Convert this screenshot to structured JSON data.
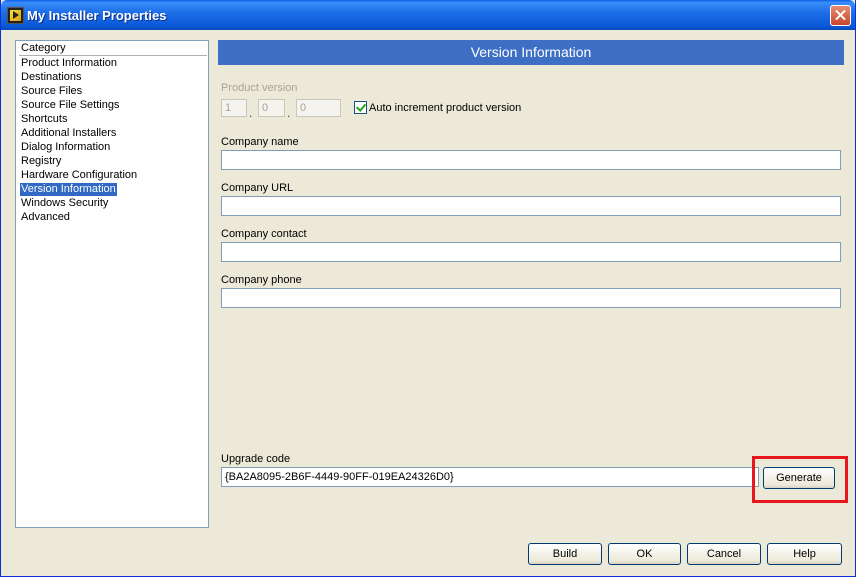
{
  "window": {
    "title": "My Installer Properties"
  },
  "sidebar": {
    "header": "Category",
    "items": [
      "Product Information",
      "Destinations",
      "Source Files",
      "Source File Settings",
      "Shortcuts",
      "Additional Installers",
      "Dialog Information",
      "Registry",
      "Hardware Configuration",
      "Version Information",
      "Windows Security",
      "Advanced"
    ],
    "selected": "Version Information"
  },
  "panel": {
    "title": "Version Information",
    "product_version": {
      "label": "Product version",
      "major": "1",
      "minor": "0",
      "fix": "0",
      "separator": ".",
      "auto_increment_label": "Auto increment product version",
      "auto_increment_checked": true
    },
    "company_name": {
      "label": "Company name",
      "value": ""
    },
    "company_url": {
      "label": "Company URL",
      "value": ""
    },
    "company_contact": {
      "label": "Company contact",
      "value": ""
    },
    "company_phone": {
      "label": "Company phone",
      "value": ""
    },
    "upgrade_code": {
      "label": "Upgrade code",
      "value": "{BA2A8095-2B6F-4449-90FF-019EA24326D0}"
    },
    "generate_label": "Generate"
  },
  "footer": {
    "build_label": "Build",
    "ok_label": "OK",
    "cancel_label": "Cancel",
    "help_label": "Help"
  },
  "colors": {
    "highlight": "#e8171e",
    "selection": "#316ac5",
    "header_bar": "#3d6fc4"
  }
}
